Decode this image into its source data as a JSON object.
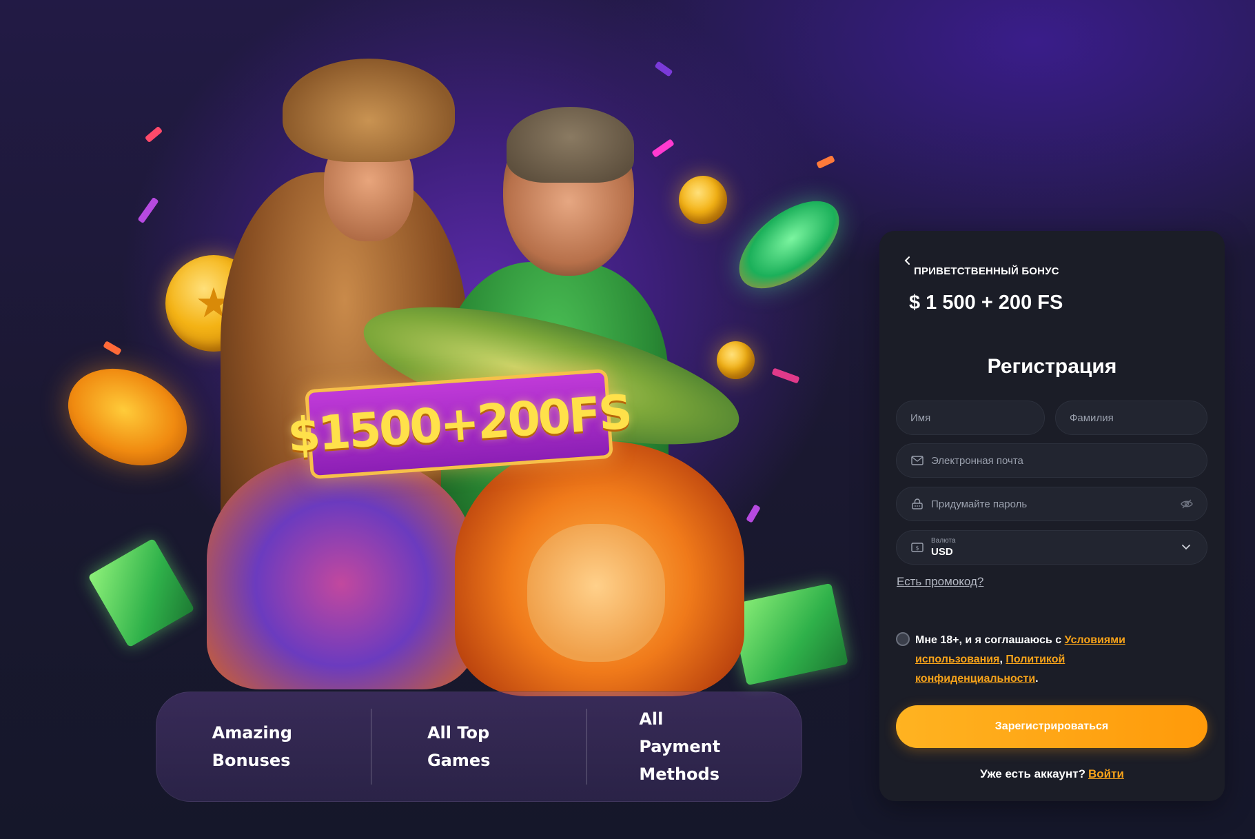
{
  "hero": {
    "promo_badge": "$1500+200FS"
  },
  "features": [
    {
      "text": "Amazing\nBonuses"
    },
    {
      "text": "All Top\nGames"
    },
    {
      "text": "All Payment\nMethods"
    }
  ],
  "registration": {
    "bonus_label": "ПРИВЕТСТВЕННЫЙ БОНУС",
    "bonus_amount": "$ 1 500 + 200 FS",
    "title": "Регистрация",
    "first_name_placeholder": "Имя",
    "last_name_placeholder": "Фамилия",
    "email_placeholder": "Электронная почта",
    "password_placeholder": "Придумайте пароль",
    "currency_label": "Валюта",
    "currency_value": "USD",
    "promo_link": "Есть промокод?",
    "consent_prefix": "Мне 18+, и я соглашаюсь с",
    "terms_link": "Условиями использования",
    "consent_sep": ",",
    "privacy_link": "Политикой конфиденциальности",
    "consent_end": ".",
    "submit_label": "Зарегистрироваться",
    "have_account": "Уже есть аккаунт?",
    "login_link": "Войти"
  },
  "colors": {
    "accent": "#f7a31a",
    "card_bg": "#1b1d27",
    "button_gradient_start": "#ffb321",
    "button_gradient_end": "#ff9a0a"
  },
  "icons": {
    "back": "chevron-left-icon",
    "email": "envelope-icon",
    "password": "lock-icon",
    "visibility": "eye-off-icon",
    "currency": "banknote-icon",
    "dropdown": "chevron-down-icon"
  }
}
